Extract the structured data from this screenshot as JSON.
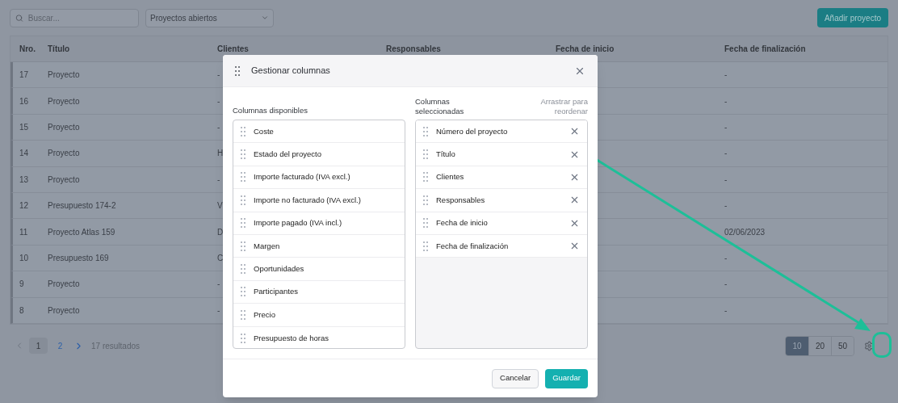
{
  "toolbar": {
    "search": {
      "placeholder": "Buscar..."
    },
    "filter": {
      "value": "Proyectos abiertos"
    },
    "add_button": "Añadir proyecto"
  },
  "table": {
    "columns": [
      "Nro.",
      "Título",
      "Clientes",
      "Responsables",
      "Fecha de inicio",
      "Fecha de finalización"
    ],
    "rows": [
      {
        "nro": "17",
        "title": "Proyecto",
        "clients": "-",
        "end_date": "-"
      },
      {
        "nro": "16",
        "title": "Proyecto",
        "clients": "-",
        "end_date": "-"
      },
      {
        "nro": "15",
        "title": "Proyecto",
        "clients": "-",
        "end_date": "-"
      },
      {
        "nro": "14",
        "title": "Proyecto",
        "clients": "H",
        "end_date": "-"
      },
      {
        "nro": "13",
        "title": "Proyecto",
        "clients": "-",
        "end_date": "-"
      },
      {
        "nro": "12",
        "title": "Presupuesto 174-2",
        "clients": "V",
        "end_date": "-"
      },
      {
        "nro": "11",
        "title": "Proyecto Atlas 159",
        "clients": "D",
        "end_date": "02/06/2023"
      },
      {
        "nro": "10",
        "title": "Presupuesto 169",
        "clients": "C",
        "end_date": "-"
      },
      {
        "nro": "9",
        "title": "Proyecto",
        "clients": "-",
        "end_date": "-"
      },
      {
        "nro": "8",
        "title": "Proyecto",
        "clients": "-",
        "end_date": "-"
      }
    ]
  },
  "pagination": {
    "pages": [
      {
        "label": "1",
        "selected": true
      },
      {
        "label": "2",
        "selected": false
      }
    ],
    "results": "17 resultados",
    "page_sizes": [
      {
        "label": "10",
        "selected": true
      },
      {
        "label": "20",
        "selected": false
      },
      {
        "label": "50",
        "selected": false
      }
    ]
  },
  "dialog": {
    "title": "Gestionar columnas",
    "available_label": "Columnas disponibles",
    "available": [
      "Coste",
      "Estado del proyecto",
      "Importe facturado (IVA excl.)",
      "Importe no facturado (IVA excl.)",
      "Importe pagado (IVA incl.)",
      "Margen",
      "Oportunidades",
      "Participantes",
      "Precio",
      "Presupuesto de horas"
    ],
    "selected_label": "Columnas seleccionadas",
    "hint": "Arrastrar para reordenar",
    "selected": [
      "Número del proyecto",
      "Título",
      "Clientes",
      "Responsables",
      "Fecha de inicio",
      "Fecha de finalización"
    ],
    "cancel": "Cancelar",
    "save": "Guardar"
  }
}
